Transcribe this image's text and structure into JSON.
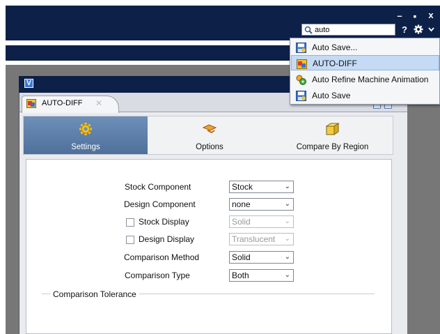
{
  "app_bar": {
    "search_value": "auto",
    "help_label": "?",
    "minimize_label": "–",
    "maximize_label": "▪",
    "close_label": "x"
  },
  "dropdown": {
    "items": [
      {
        "label": "Auto Save...",
        "icon": "auto-save-icon",
        "highlighted": false
      },
      {
        "label": "AUTO-DIFF",
        "icon": "auto-diff-icon",
        "highlighted": true
      },
      {
        "label": "Auto Refine Machine Animation",
        "icon": "machine-animation-icon",
        "highlighted": false
      },
      {
        "label": "Auto Save",
        "icon": "auto-save-icon",
        "highlighted": false
      }
    ]
  },
  "window": {
    "tab_label": "AUTO-DIFF",
    "modes": [
      {
        "label": "Settings",
        "icon": "gear-icon",
        "selected": true
      },
      {
        "label": "Options",
        "icon": "options-icon",
        "selected": false
      },
      {
        "label": "Compare By Region",
        "icon": "box-icon",
        "selected": false
      }
    ]
  },
  "form": {
    "stock_component": {
      "label": "Stock Component",
      "value": "Stock"
    },
    "design_component": {
      "label": "Design Component",
      "value": "none"
    },
    "stock_display": {
      "label": "Stock Display",
      "value": "Solid",
      "checked": false,
      "enabled": false
    },
    "design_display": {
      "label": "Design Display",
      "value": "Translucent",
      "checked": false,
      "enabled": false
    },
    "comparison_method": {
      "label": "Comparison Method",
      "value": "Solid"
    },
    "comparison_type": {
      "label": "Comparison Type",
      "value": "Both"
    },
    "tolerance_group_label": "Comparison Tolerance"
  },
  "colors": {
    "title_bar": "#0d2048",
    "selected_mode": "#5a7ca7",
    "highlight": "#c5daf4"
  }
}
